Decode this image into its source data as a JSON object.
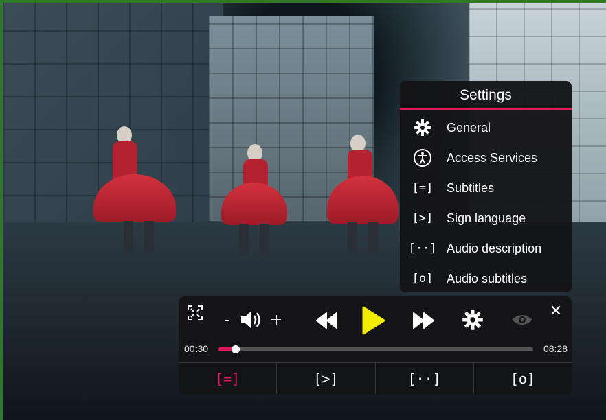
{
  "settings": {
    "title": "Settings",
    "items": [
      {
        "label": "General",
        "icon": "gear-icon"
      },
      {
        "label": "Access Services",
        "icon": "accessibility-icon"
      },
      {
        "label": "Subtitles",
        "icon": "subtitles-icon",
        "glyph": "[=]"
      },
      {
        "label": "Sign language",
        "icon": "sign-language-icon",
        "glyph": "[>]"
      },
      {
        "label": "Audio description",
        "icon": "audio-description-icon",
        "glyph": "[··]"
      },
      {
        "label": "Audio subtitles",
        "icon": "audio-subtitles-icon",
        "glyph": "[o]"
      }
    ]
  },
  "controls": {
    "volume_minus": "-",
    "volume_plus": "+",
    "close": "✕",
    "current_time": "00:30",
    "total_time": "08:28",
    "progress": 0.055,
    "tabs": [
      {
        "glyph": "[=]",
        "name": "subtitles"
      },
      {
        "glyph": "[>]",
        "name": "sign-language"
      },
      {
        "glyph": "[··]",
        "name": "audio-description"
      },
      {
        "glyph": "[o]",
        "name": "audio-subtitles"
      }
    ]
  },
  "colors": {
    "accent": "#e0195a",
    "play": "#f2ec00",
    "panel": "#141416"
  }
}
